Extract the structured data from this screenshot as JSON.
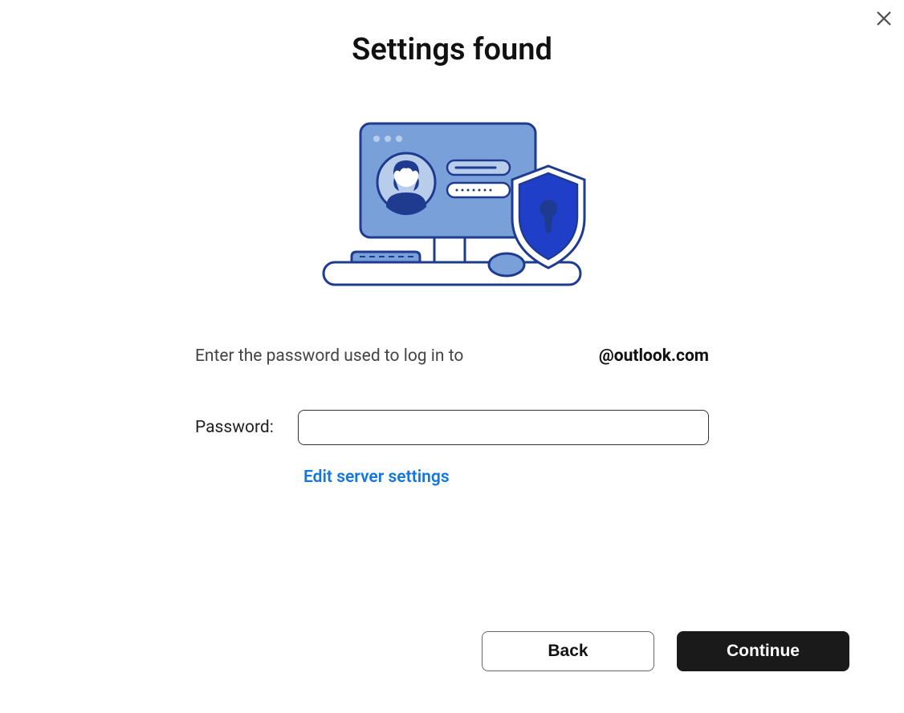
{
  "title": "Settings found",
  "instruction": "Enter the password used to log in to",
  "email_domain": "@outlook.com",
  "password_label": "Password:",
  "password_value": "",
  "edit_server_link": "Edit server settings",
  "buttons": {
    "back": "Back",
    "continue": "Continue"
  }
}
